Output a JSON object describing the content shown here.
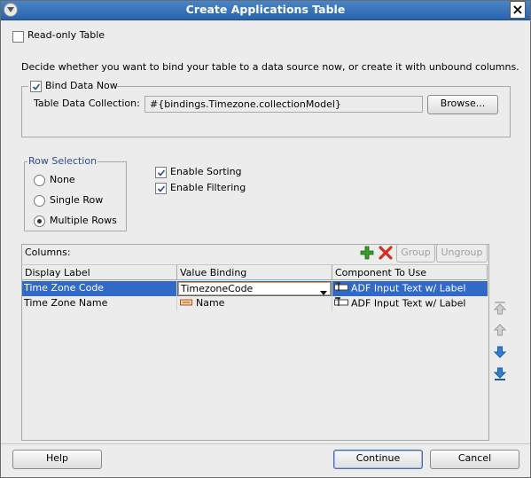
{
  "window": {
    "title": "Create Applications Table"
  },
  "readonly": {
    "label": "Read-only Table",
    "checked": false
  },
  "description": "Decide whether you want to bind your table to a data source now, or create it with unbound columns.",
  "bind": {
    "label": "Bind Data Now",
    "checked": true,
    "collection_label": "Table Data Collection:",
    "collection_value": "#{bindings.Timezone.collectionModel}",
    "browse_label": "Browse..."
  },
  "row_selection": {
    "legend": "Row Selection",
    "options": [
      "None",
      "Single Row",
      "Multiple Rows"
    ],
    "selected": "Multiple Rows"
  },
  "options": {
    "sorting": {
      "label": "Enable Sorting",
      "checked": true
    },
    "filtering": {
      "label": "Enable Filtering",
      "checked": true
    }
  },
  "columns": {
    "label": "Columns:",
    "group_label": "Group",
    "ungroup_label": "Ungroup",
    "headers": [
      "Display Label",
      "Value Binding",
      "Component To Use"
    ],
    "rows": [
      {
        "display": "Time Zone Code",
        "binding": "TimezoneCode",
        "component": "ADF Input Text w/ Label",
        "selected": true
      },
      {
        "display": "Time Zone Name",
        "binding": "Name",
        "component": "ADF Input Text w/ Label",
        "selected": false
      }
    ]
  },
  "footer": {
    "help_label": "Help",
    "continue_label": "Continue",
    "cancel_label": "Cancel"
  },
  "colors": {
    "selection": "#3169c6",
    "titlebar": "#2a63ad",
    "add_icon": "#3a9a2a",
    "delete_icon": "#d43020",
    "arrow_icon": "#2f7fd8"
  }
}
